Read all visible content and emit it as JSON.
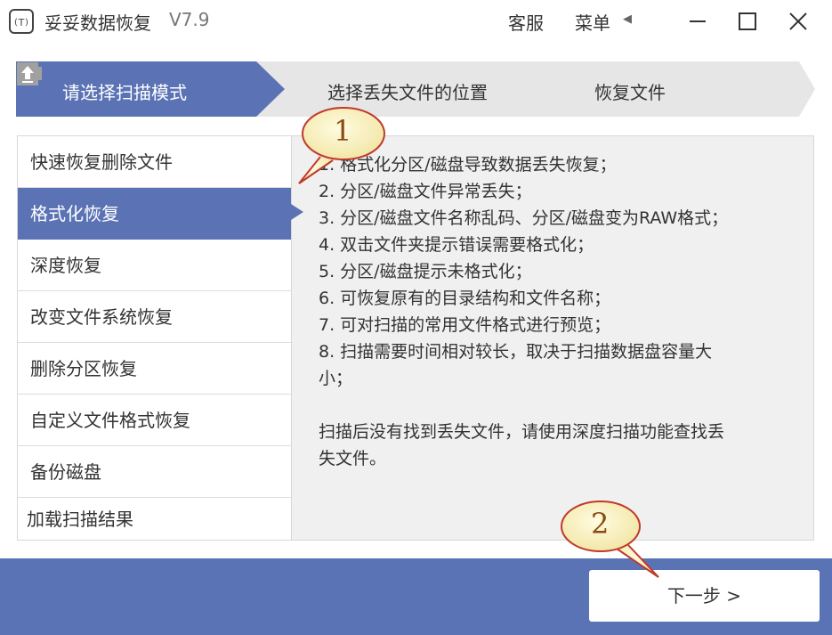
{
  "window": {
    "title": "妥妥数据恢复",
    "version": "V7.9",
    "service_label": "客服",
    "menu_label": "菜单",
    "menu_arrow": "◀"
  },
  "steps": [
    {
      "label": "请选择扫描模式",
      "icon": "search-icon",
      "active": true
    },
    {
      "label": "选择丢失文件的位置",
      "icon": "folder-icon",
      "active": false
    },
    {
      "label": "恢复文件",
      "icon": "upload-icon",
      "active": false
    }
  ],
  "modes": [
    {
      "label": "快速恢复删除文件"
    },
    {
      "label": "格式化恢复",
      "active": true
    },
    {
      "label": "深度恢复"
    },
    {
      "label": "改变文件系统恢复"
    },
    {
      "label": "删除分区恢复"
    },
    {
      "label": "自定义文件格式恢复"
    },
    {
      "label": "备份磁盘"
    },
    {
      "label": "加载扫描结果"
    }
  ],
  "description": {
    "lines": [
      "1. 格式化分区/磁盘导致数据丢失恢复；",
      "2. 分区/磁盘文件异常丢失；",
      "3. 分区/磁盘文件名称乱码、分区/磁盘变为RAW格式；",
      "4. 双击文件夹提示错误需要格式化；",
      "5. 分区/磁盘提示未格式化；",
      "6. 可恢复原有的目录结构和文件名称；",
      "7. 可对扫描的常用文件格式进行预览；",
      "8. 扫描需要时间相对较长，取决于扫描数据盘容量大",
      "小；"
    ],
    "note_lines": [
      "扫描后没有找到丢失文件，请使用深度扫描功能查找丢",
      "失文件。"
    ]
  },
  "next_button": {
    "label": "下一步 >"
  },
  "callouts": [
    {
      "number": "1"
    },
    {
      "number": "2"
    }
  ],
  "colors": {
    "accent": "#5b73b4",
    "step_inactive": "#e6e6e6",
    "callout_fill": "#f8f2c8",
    "callout_border": "#c0392b"
  }
}
